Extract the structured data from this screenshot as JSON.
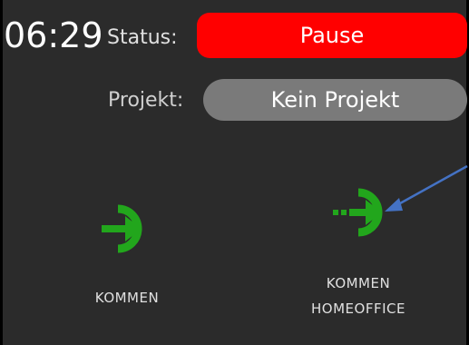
{
  "header": {
    "time": "06:29",
    "status_label": "Status:",
    "status_value": "Pause",
    "status_color": "#ff0000"
  },
  "project": {
    "label": "Projekt:",
    "value": "Kein Projekt"
  },
  "actions": [
    {
      "label": "KOMMEN",
      "icon": "login-arrow-icon",
      "color": "#22a61c"
    },
    {
      "label": "KOMMEN\nHOMEOFFICE",
      "icon": "login-dashed-arrow-icon",
      "color": "#22a61c"
    }
  ],
  "annotation_color": "#4472c4"
}
